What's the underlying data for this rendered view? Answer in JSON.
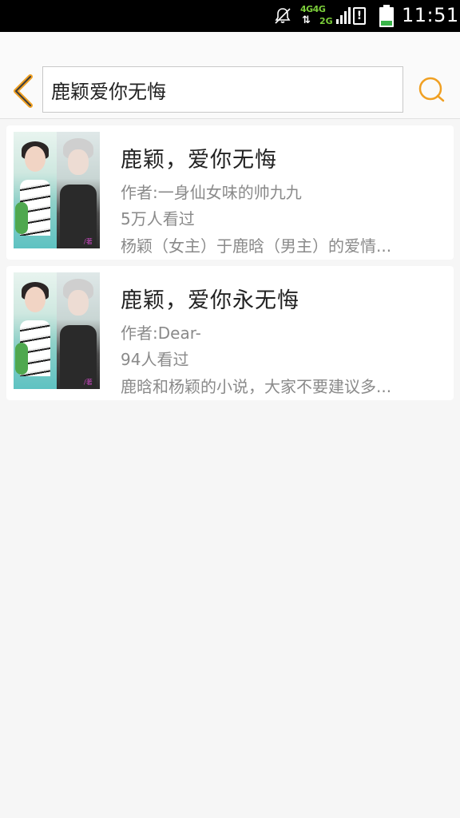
{
  "status_bar": {
    "network_top": "4G4G",
    "network_bottom": "2G",
    "alert_glyph": "!",
    "time": "11:51"
  },
  "header": {
    "back_icon": "chevron-left-icon",
    "search_icon": "search-icon",
    "search_value": "鹿颖爱你无悔",
    "accent_color": "#f0a023"
  },
  "results": [
    {
      "title": "鹿颖，爱你无悔",
      "author": "作者:一身仙女味的帅九九",
      "views": "5万人看过",
      "description": "杨颖（女主）于鹿晗（男主）的爱情..."
    },
    {
      "title": "鹿颖，爱你永无悔",
      "author": "作者:Dear-",
      "views": "94人看过",
      "description": "鹿晗和杨颖的小说，大家不要建议多..."
    }
  ]
}
